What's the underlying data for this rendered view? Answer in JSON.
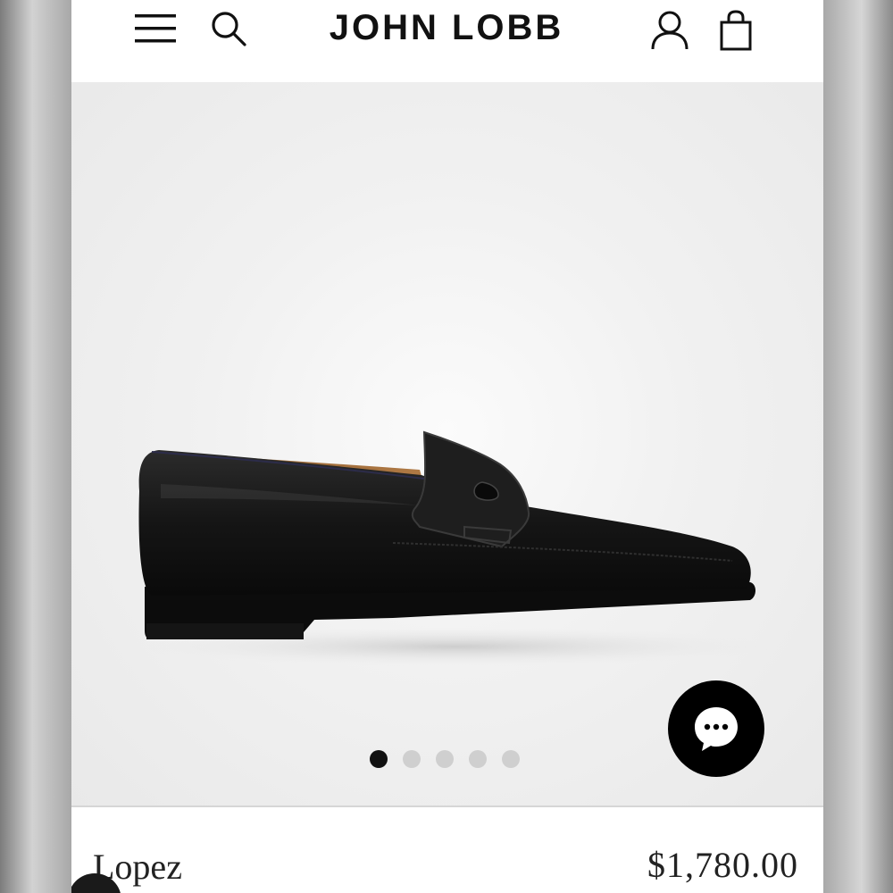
{
  "header": {
    "brand": "JOHN LOBB",
    "icons": {
      "menu": "menu-icon",
      "search": "search-icon",
      "account": "account-icon",
      "bag": "shopping-bag-icon"
    }
  },
  "gallery": {
    "image_alt": "shoe-image",
    "slide_count": 5,
    "active_slide": 1
  },
  "chat": {
    "icon": "chat-bubble-icon"
  },
  "product": {
    "name": "Lopez",
    "price": "$1,780.00"
  },
  "colors": {
    "background": "#ffffff",
    "gallery_bg": "#efefef",
    "text": "#111111",
    "dot_active": "#111111",
    "dot_inactive": "#cfcfcf"
  }
}
